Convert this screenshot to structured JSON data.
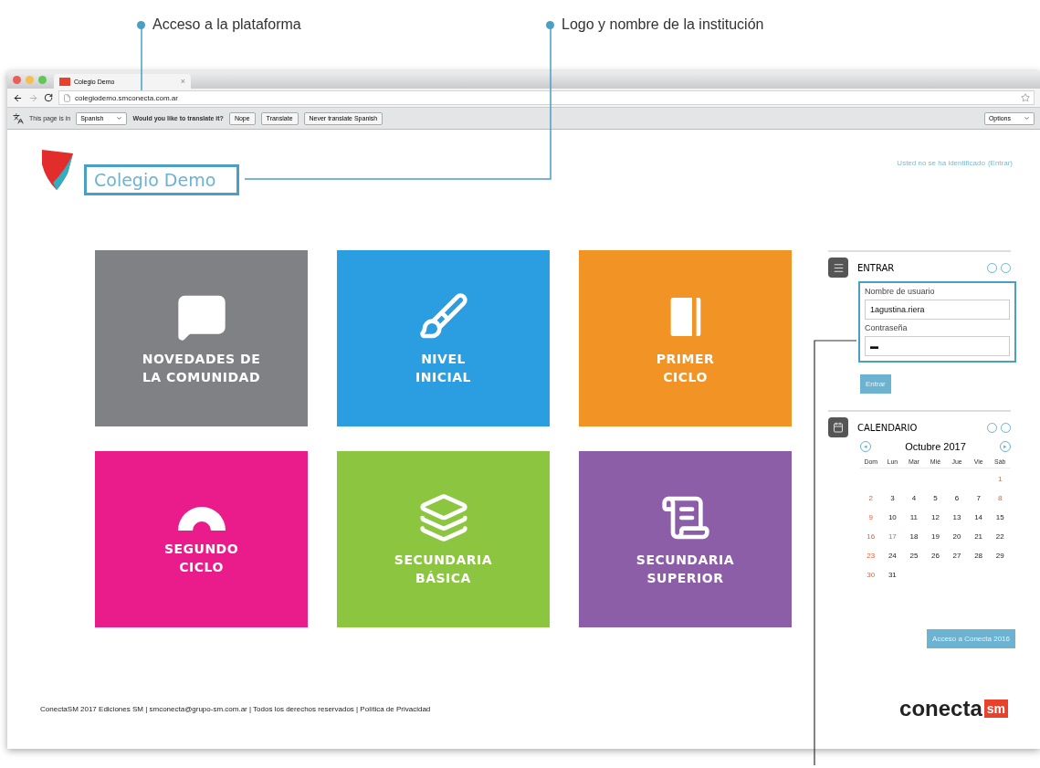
{
  "callouts": [
    {
      "label": "Acceso a la plataforma"
    },
    {
      "label": "Logo y nombre de la institución"
    }
  ],
  "browser": {
    "tab": {
      "title": "Colegio Demo",
      "close": "×"
    },
    "url": "colegiodemo.smconecta.com.ar",
    "translate_bar": {
      "text_before": "This page is in",
      "language": "Spanish",
      "question": "Would you like to translate it?",
      "buttons": [
        "Nope",
        "Translate",
        "Never translate Spanish"
      ],
      "options": "Options"
    }
  },
  "header": {
    "title": "Colegio Demo",
    "login_status": "Usted no se ha identificado",
    "login_link": "(Entrar)"
  },
  "tiles": [
    {
      "kind": "bubble",
      "color": "#808184",
      "lines": [
        "NOVEDADES DE",
        "LA COMUNIDAD"
      ]
    },
    {
      "kind": "brush",
      "color": "#2a9ee0",
      "lines": [
        "NIVEL",
        "INICIAL"
      ]
    },
    {
      "kind": "notebook",
      "color": "#f29325",
      "lines": [
        "PRIMER",
        "CICLO"
      ]
    },
    {
      "kind": "protractor",
      "color": "#ea1c8c",
      "lines": [
        "SEGUNDO",
        "CICLO"
      ]
    },
    {
      "kind": "books",
      "color": "#8cc640",
      "lines": [
        "SECUNDARIA",
        "BÁSICA"
      ]
    },
    {
      "kind": "diploma",
      "color": "#8d5ea8",
      "lines": [
        "SECUNDARIA",
        "SUPERIOR"
      ]
    }
  ],
  "login": {
    "title": "ENTRAR",
    "username_label": "Nombre de usuario",
    "username": "1agustina.riera",
    "password_label": "Contraseña",
    "password": "▬",
    "button": "Entrar"
  },
  "calendar": {
    "title": "CALENDARIO",
    "month": "Octubre 2017",
    "prev": "◂",
    "next": "▸",
    "weekdays": [
      "Dom",
      "Lun",
      "Mar",
      "Mié",
      "Jue",
      "Vie",
      "Sáb"
    ],
    "weeks": [
      [
        {
          "day": "1",
          "red": true
        }
      ],
      [
        {
          "day": "2",
          "red": true
        },
        {
          "day": "3",
          "red": false
        },
        {
          "day": "4",
          "red": false
        },
        {
          "day": "5",
          "red": false
        },
        {
          "day": "6",
          "red": false
        },
        {
          "day": "7",
          "red": false
        },
        {
          "day": "8",
          "red": true
        }
      ],
      [
        {
          "day": "9",
          "red": true
        },
        {
          "day": "10",
          "red": false
        },
        {
          "day": "11",
          "red": false
        },
        {
          "day": "12",
          "red": false
        },
        {
          "day": "13",
          "red": false
        },
        {
          "day": "14",
          "red": false
        },
        {
          "day": "15",
          "red": false
        }
      ],
      [
        {
          "day": "16",
          "red": true
        },
        {
          "day": "17",
          "red": true
        },
        {
          "day": "18",
          "red": false
        },
        {
          "day": "19",
          "red": false
        },
        {
          "day": "20",
          "red": false
        },
        {
          "day": "21",
          "red": false
        },
        {
          "day": "22",
          "red": false
        }
      ],
      [
        {
          "day": "23",
          "red": true
        },
        {
          "day": "24",
          "red": false
        },
        {
          "day": "25",
          "red": false
        },
        {
          "day": "26",
          "red": false
        },
        {
          "day": "27",
          "red": false
        },
        {
          "day": "28",
          "red": false
        },
        {
          "day": "29",
          "red": false
        }
      ],
      [
        {
          "day": "30",
          "red": true
        },
        {
          "day": "31",
          "red": false
        }
      ]
    ]
  },
  "access_button": "Acceso a Conecta 2016",
  "footer": {
    "text": "ConectaSM 2017 Ediciones SM | smconecta@grupo-sm.com.ar | Todos los derechos reservados | Política de Privacidad",
    "brand": "conecta",
    "brand_badge": "sm"
  }
}
